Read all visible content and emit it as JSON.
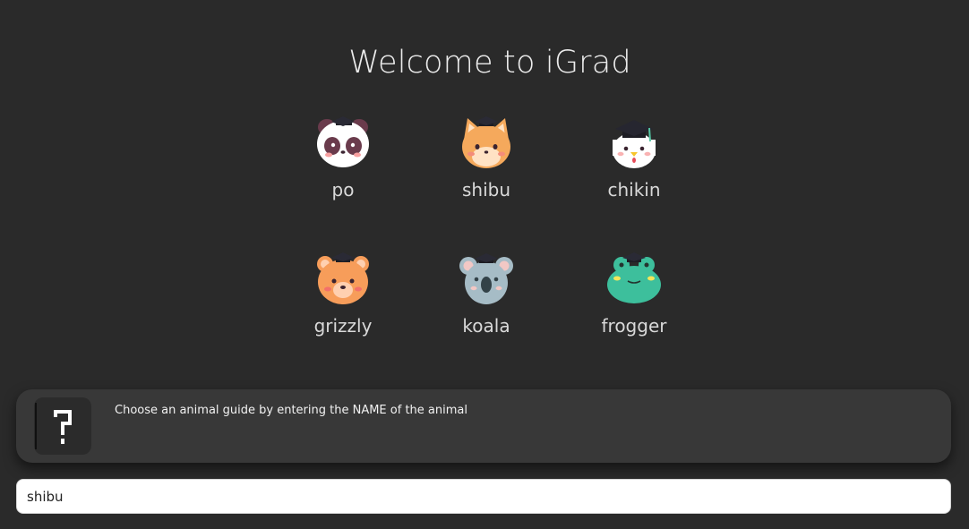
{
  "title": "Welcome to iGrad",
  "animals": [
    {
      "name": "po",
      "icon": "panda-graduate-icon"
    },
    {
      "name": "shibu",
      "icon": "shiba-graduate-icon"
    },
    {
      "name": "chikin",
      "icon": "chicken-graduate-icon"
    },
    {
      "name": "grizzly",
      "icon": "bear-graduate-icon"
    },
    {
      "name": "koala",
      "icon": "koala-graduate-icon"
    },
    {
      "name": "frogger",
      "icon": "frog-graduate-icon"
    }
  ],
  "guide": {
    "avatar_icon": "question-mark-icon",
    "message": "Choose an animal guide by entering the NAME of the animal"
  },
  "input": {
    "value": "shibu"
  },
  "colors": {
    "background": "#2a2a2a",
    "card": "#383838",
    "text": "#ececec"
  }
}
